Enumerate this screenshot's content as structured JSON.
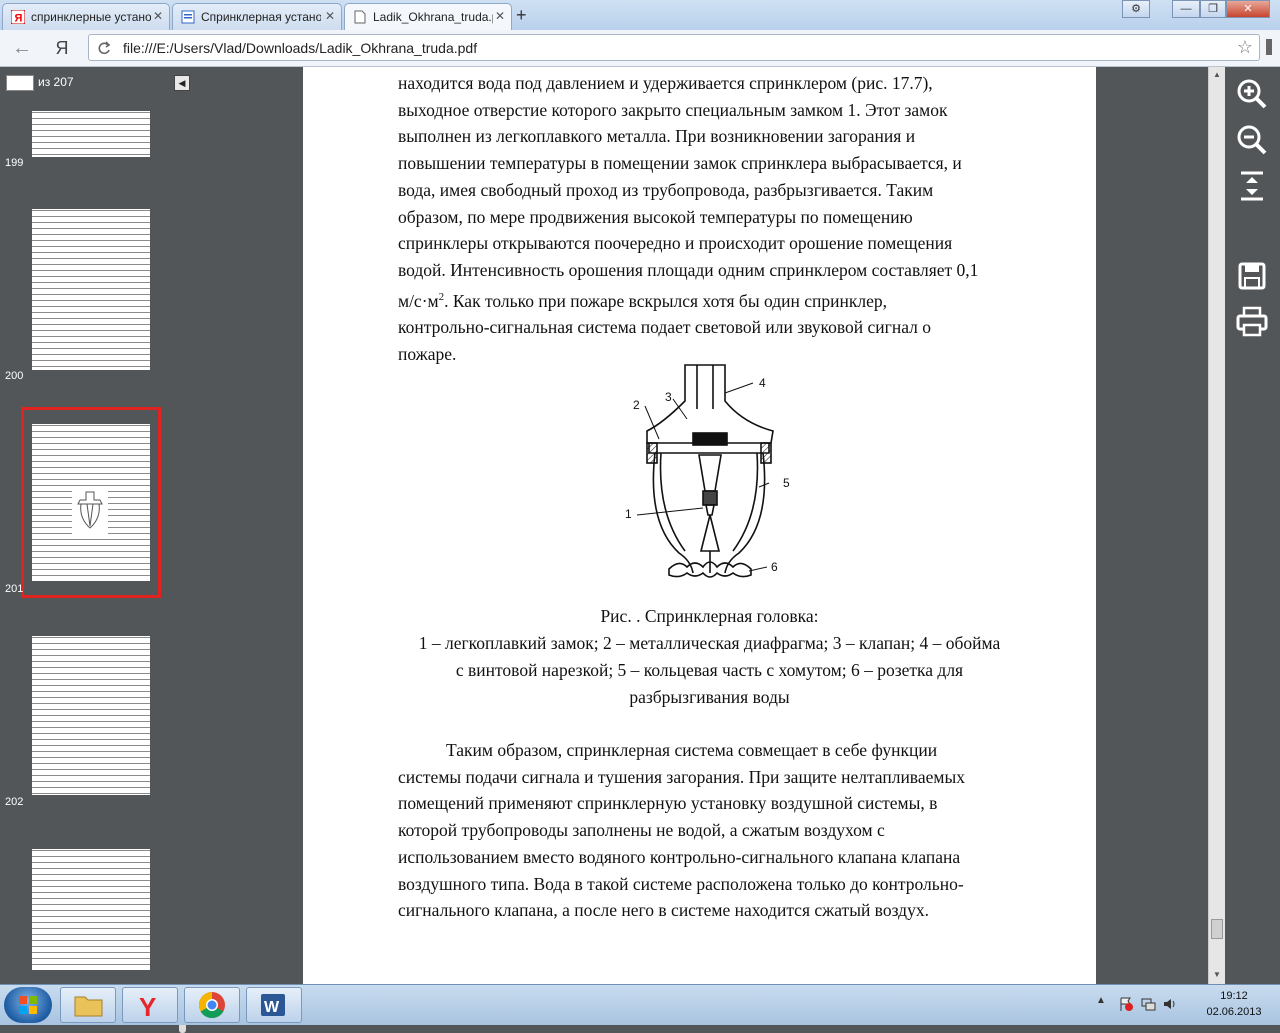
{
  "browser": {
    "tabs": [
      {
        "label": "спринклерные устано",
        "icon": "yandex-favicon"
      },
      {
        "label": "Спринклерная устано",
        "icon": "page-favicon"
      },
      {
        "label": "Ladik_Okhrana_truda.p",
        "icon": "document-favicon",
        "active": true
      }
    ],
    "new_tab": "+",
    "url": "file:///E:/Users/Vlad/Downloads/Ladik_Okhrana_truda.pdf",
    "home_glyph": "Я"
  },
  "pdf": {
    "page_count_label": "из 207",
    "current_page_input": "",
    "thumbnails": [
      {
        "num": "199"
      },
      {
        "num": "200"
      },
      {
        "num": "201",
        "selected": true
      },
      {
        "num": "202"
      },
      {
        "num": ""
      }
    ],
    "paragraph1": {
      "line1": "находится вода под давлением и удерживается спринклером (рис. 17.7),",
      "line2": "выходное отверстие которого закрыто специальным замком 1. Этот замок",
      "line3": "выполнен из легкоплавкого металла. При возникновении загорания и",
      "line4": "повышении температуры в помещении замок спринклера выбрасывается, и",
      "line5": "вода, имея свободный проход из трубопровода, разбрызгивается. Таким",
      "line6": "образом, по мере продвижения высокой температуры по помещению",
      "line7": "спринклеры открываются поочередно и происходит орошение помещения",
      "line8": "водой. Интенсивность орошения площади одним спринклером составляет 0,1",
      "line9_pre": "м/с·м",
      "line9_sup": "2",
      "line9_post": ". Как только при пожаре вскрылся хотя бы один спринклер,",
      "line10": "контрольно-сигнальная система подает световой или звуковой сигнал о",
      "line11": "пожаре."
    },
    "figure": {
      "labels": [
        "1",
        "2",
        "3",
        "4",
        "5",
        "6"
      ]
    },
    "caption": {
      "title": "Рис. . Спринклерная головка:",
      "line1": "1 – легкоплавкий замок; 2 – металлическая диафрагма; 3 – клапан; 4 – обойма",
      "line2": "с винтовой нарезкой; 5 – кольцевая часть с хомутом; 6 – розетка для",
      "line3": "разбрызгивания воды"
    },
    "paragraph2": {
      "line1": "Таким образом, спринклерная система совмещает в себе функции",
      "line2": "системы подачи сигнала и тушения загорания. При защите нелтапливаемых",
      "line3": "помещений применяют спринклерную установку воздушной системы, в",
      "line4": "которой трубопроводы заполнены не водой, а сжатым воздухом с",
      "line5": "использованием вместо водяного контрольно-сигнального клапана клапана",
      "line6": "воздушного типа. Вода в такой системе расположена только до контрольно-",
      "line7": "сигнального клапана, а после него в системе находится сжатый воздух."
    }
  },
  "taskbar": {
    "clock_time": "19:12",
    "clock_date": "02.06.2013"
  }
}
